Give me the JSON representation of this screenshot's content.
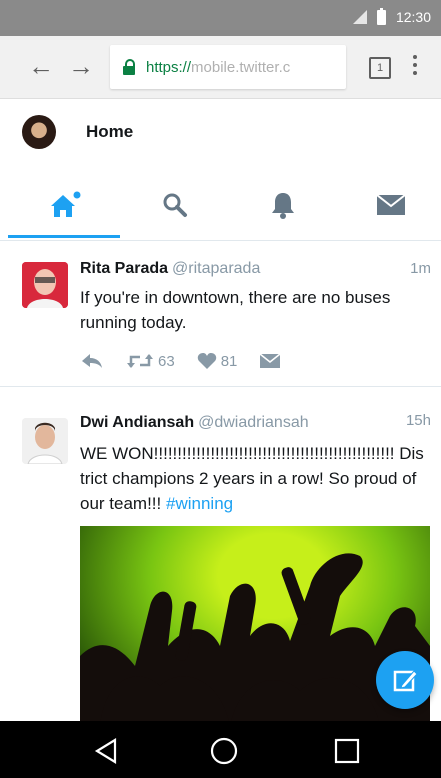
{
  "status_bar": {
    "time": "12:30"
  },
  "browser": {
    "url_secure": "https://",
    "url_rest": "mobile.twitter.c",
    "tab_count": "1"
  },
  "header": {
    "title": "Home"
  },
  "tabs": [
    "home",
    "search",
    "notifications",
    "messages"
  ],
  "tweets": [
    {
      "name": "Rita Parada",
      "handle": "@ritaparada",
      "time": "1m",
      "text": "If you're in downtown, there are no buses running today.",
      "retweets": "63",
      "likes": "81"
    },
    {
      "name": "Dwi Andiansah",
      "handle": "@dwiadriansah",
      "time": "15h",
      "text": "WE WON!!!!!!!!!!!!!!!!!!!!!!!!!!!!!!!!!!!!!!!!!!!!!!!!!!! District champions 2 years in a row! So proud of our team!!!",
      "hashtag": "#winning"
    }
  ],
  "colors": {
    "accent": "#1da1f2",
    "status_bar": "#8a8a8a",
    "secure": "#0b8043"
  }
}
